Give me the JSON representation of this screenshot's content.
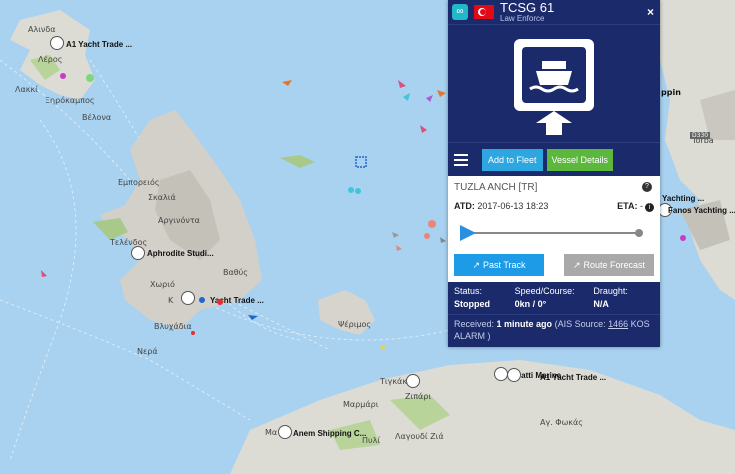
{
  "vessel": {
    "name": "TCSG 61",
    "type": "Law Enforce",
    "close_label": "×"
  },
  "toolbar": {
    "add_fleet": "Add to Fleet",
    "vessel_details": "Vessel Details"
  },
  "voyage": {
    "destination": "TUZLA ANCH [TR]",
    "atd_label": "ATD:",
    "atd_value": "2017-06-13 18:23",
    "eta_label": "ETA:",
    "eta_value": "-",
    "past_track": "Past Track",
    "route_forecast": "Route Forecast"
  },
  "status": {
    "status_label": "Status:",
    "status_value": "Stopped",
    "speed_label": "Speed/Course:",
    "speed_value": "0kn / 0°",
    "draught_label": "Draught:",
    "draught_value": "N/A"
  },
  "received": {
    "label": "Received:",
    "age": "1 minute ago",
    "source_prefix": "(AIS Source:",
    "source_id": "1466",
    "source_suffix": "KOS ALARM )"
  },
  "map": {
    "place_labels": [
      "Αλινδα",
      "Λέρος",
      "Λακκί",
      "Ξηρόκαμπος",
      "Βέλονα",
      "Εμπορειός",
      "Σκαλιά",
      "Αργινόντα",
      "Τελένδος",
      "Βαθύς",
      "Χωριό",
      "Κ",
      "Βλυχάδια",
      "Νερά",
      "Ψέριμος",
      "Τιγκάκι",
      "Μαρμάρι",
      "Ζιπάρι",
      "Μα",
      "Πυλί",
      "Λαγουδί Ζιά",
      "Αγ. Φωκάς",
      "Torba",
      "D330",
      "ppin"
    ],
    "markers": [
      "A1 Yacht Trade ...",
      "Aphrodite Studi...",
      "Yacht Trade ...",
      "Anem Shipping C...",
      "ratti Marine",
      "A1 Yacht Trade ...",
      "Yachting ...",
      "Fanos Yachting ..."
    ]
  },
  "colors": {
    "panel_bg": "#1b2a6b",
    "sea": "#a8d2f0",
    "land": "#dcdcd4",
    "add_fleet": "#2ea7e0",
    "vessel_details": "#5cb83c",
    "past_track": "#1e9be6",
    "route_forecast": "#a9a9a9"
  }
}
